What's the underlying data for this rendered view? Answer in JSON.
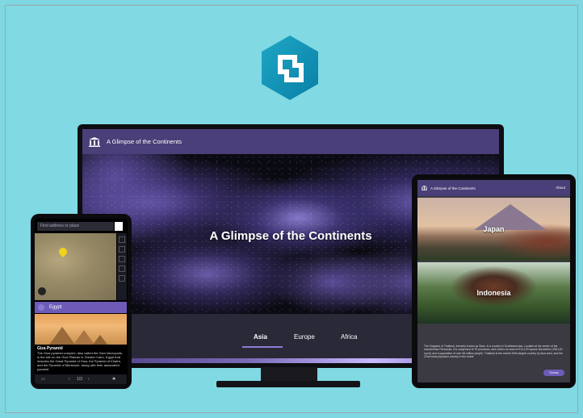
{
  "brand": {
    "logo_icon": "storymaps-logo-icon"
  },
  "monitor": {
    "header_title": "A Glimpse of the Continents",
    "hero_title": "A Glimpse of the Continents",
    "tabs": [
      {
        "label": "Asia",
        "active": true
      },
      {
        "label": "Europe",
        "active": false
      },
      {
        "label": "Africa",
        "active": false
      }
    ]
  },
  "phone": {
    "search_placeholder": "Find address or place",
    "location_label": "Egypt",
    "caption_title": "Giza Pyramid",
    "caption_body": "The Giza pyramid complex, also called the Giza Necropolis, is the site on the Giza Plateau in Greater Cairo, Egypt that includes the Great Pyramid of Giza, the Pyramid of Khafre, and the Pyramid of Menkaure, along with their associated pyramid",
    "pager": "1/3"
  },
  "tablet": {
    "header_title": "A Glimpse of the Continents",
    "about_label": "About",
    "cards": [
      {
        "label": "Japan"
      },
      {
        "label": "Indonesia"
      }
    ],
    "body_text": "The Kingdom of Thailand, formerly known as Siam, is a country in Southeast Asia. Located at the center of the Indochinese Peninsula, it is composed of 76 provinces, and covers an area of 513,120 square kilometers (198,120 sq mi) and a population of over 66 million people. Thailand is the world's 50th-largest country by land area, and the 22nd-most-populous country in the world.",
    "button_label": "Survey"
  },
  "colors": {
    "background": "#80d9e3",
    "header_purple": "#4a3f78",
    "accent_purple": "#6e5bb8"
  }
}
